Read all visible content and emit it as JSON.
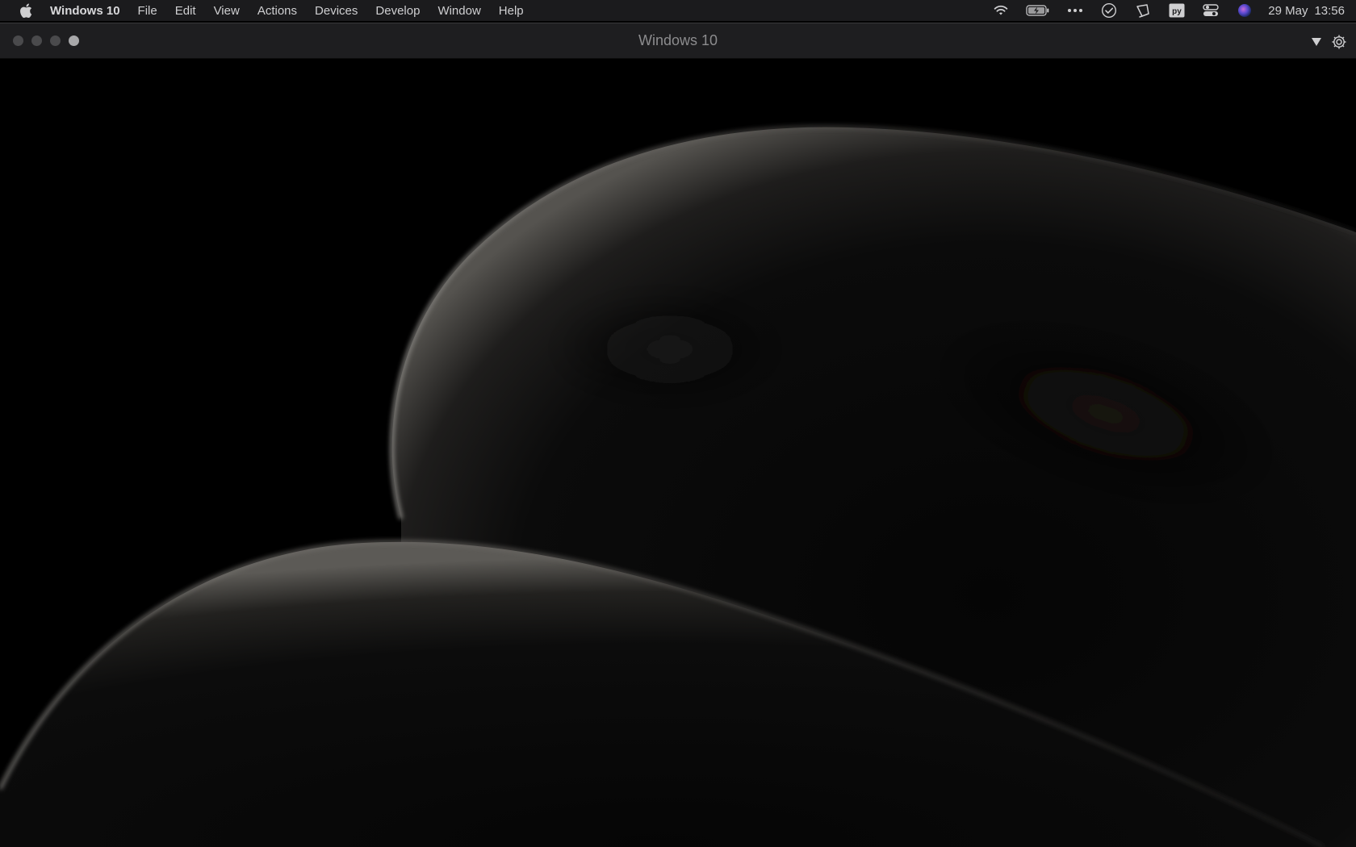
{
  "menubar": {
    "app_name": "Windows 10",
    "menus": [
      "File",
      "Edit",
      "View",
      "Actions",
      "Devices",
      "Develop",
      "Window",
      "Help"
    ],
    "status_icons": [
      "wifi-icon",
      "battery-charging-icon",
      "more-icon",
      "checkmark-circle-icon",
      "display-icon",
      "python-icon",
      "control-center-icon",
      "siri-icon"
    ],
    "date": "29 May",
    "time": "13:56"
  },
  "window": {
    "title": "Windows 10",
    "controls": [
      "dropdown-arrow-icon",
      "gear-icon"
    ]
  },
  "colors": {
    "menubar_bg": "#1b1b1d",
    "titlebar_bg": "#1e1e20",
    "desktop_bg": "#000000",
    "shape_highlight": "#6a6a6c"
  }
}
